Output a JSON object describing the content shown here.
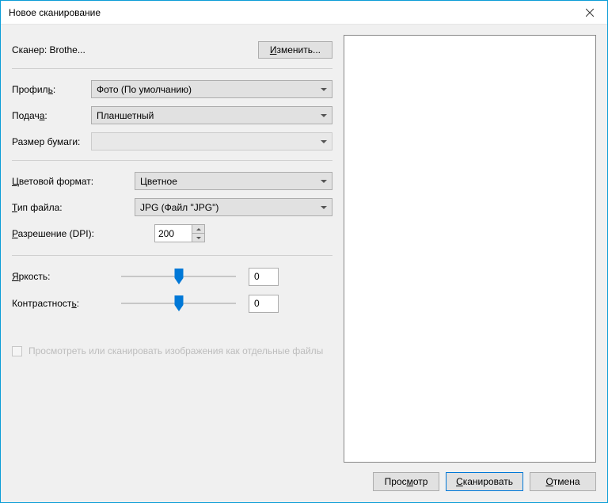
{
  "title": "Новое сканирование",
  "scanner": {
    "label": "Сканер: Brothe...",
    "change_btn": "Изменить..."
  },
  "labels": {
    "profile": "Профиль:",
    "source": "Подача:",
    "paper_size": "Размер бумаги:",
    "color_format": "Цветовой формат:",
    "file_type": "Тип файла:",
    "resolution": "Разрешение (DPI):",
    "brightness": "Яркость:",
    "contrast": "Контрастность:"
  },
  "values": {
    "profile": "Фото (По умолчанию)",
    "source": "Планшетный",
    "paper_size": "",
    "color_format": "Цветное",
    "file_type": "JPG (Файл \"JPG\")",
    "resolution": "200",
    "brightness": "0",
    "contrast": "0"
  },
  "checkbox_label": "Просмотреть или сканировать изображения как отдельные файлы",
  "footer": {
    "preview": "Просмотр",
    "scan": "Сканировать",
    "cancel": "Отмена"
  },
  "accel": {
    "change": "И",
    "profile": "ь",
    "source": "а",
    "color": "Ц",
    "type": "Т",
    "res": "Р",
    "bright": "Я",
    "contrast": "ь",
    "prev": "м",
    "scan": "С",
    "cancel": "О"
  }
}
